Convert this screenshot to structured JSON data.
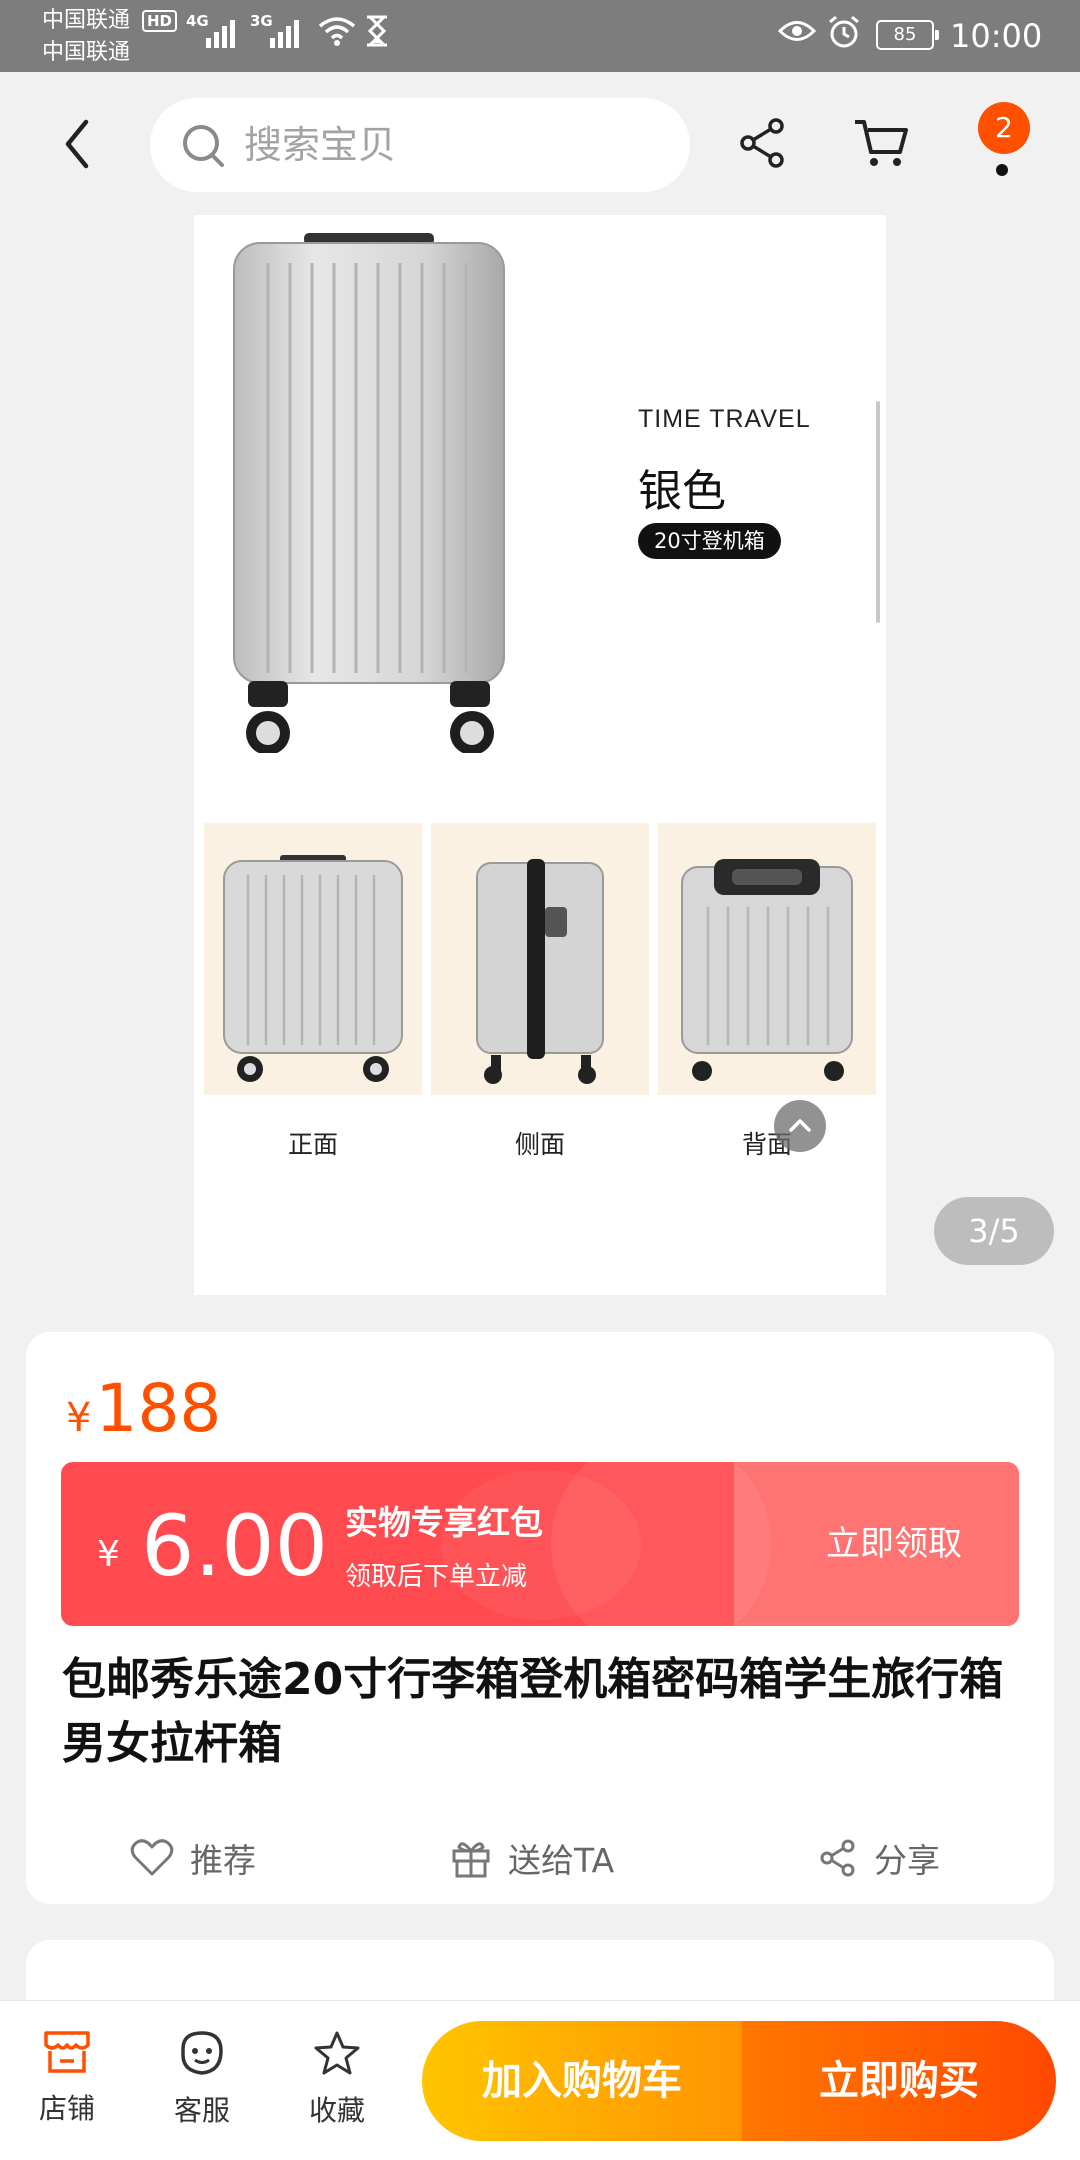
{
  "status_bar": {
    "carrier1": "中国联通",
    "carrier2": "中国联通",
    "hd": "HD",
    "net1": "4G",
    "net2": "3G",
    "battery": "85",
    "time": "10:00"
  },
  "nav": {
    "search_placeholder": "搜索宝贝",
    "cart_badge": "2"
  },
  "gallery": {
    "brand_line": "TIME TRAVEL",
    "color_name": "银色",
    "size_tag": "20寸登机箱",
    "views": [
      "正面",
      "侧面",
      "背面"
    ],
    "page_counter": "3/5"
  },
  "product": {
    "currency": "¥",
    "price": "188",
    "coupon": {
      "currency": "¥",
      "amount": "6.00",
      "title": "实物专享红包",
      "subtitle": "领取后下单立减",
      "cta": "立即领取"
    },
    "title": "包邮秀乐途20寸行李箱登机箱密码箱学生旅行箱男女拉杆箱",
    "actions": [
      "推荐",
      "送给TA",
      "分享"
    ]
  },
  "bottom_bar": {
    "shop": "店铺",
    "service": "客服",
    "favorite": "收藏",
    "add_to_cart": "加入购物车",
    "buy_now": "立即购买"
  },
  "colors": {
    "accent": "#ff5000",
    "coupon_red": "#ff4b4f",
    "cart_gradient_start": "#ffc500",
    "buy_gradient_end": "#ff4900"
  }
}
